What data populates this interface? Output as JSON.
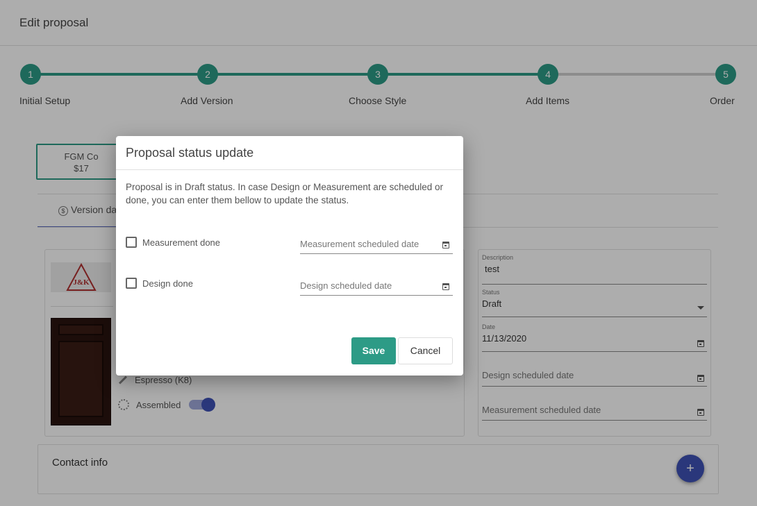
{
  "page": {
    "title": "Edit proposal"
  },
  "stepper": {
    "steps": [
      {
        "number": "1",
        "label": "Initial Setup"
      },
      {
        "number": "2",
        "label": "Add Version"
      },
      {
        "number": "3",
        "label": "Choose Style"
      },
      {
        "number": "4",
        "label": "Add Items"
      },
      {
        "number": "5",
        "label": "Order"
      }
    ],
    "completed_through": 4,
    "accent_color": "#2d9b86"
  },
  "version_card": {
    "name": "FGM Co",
    "price": "$17"
  },
  "tabs": {
    "active_label": "Version da"
  },
  "style": {
    "finish": "Espresso (K8)",
    "assembled_label": "Assembled",
    "assembled": true
  },
  "details": {
    "description_label": "Description",
    "description_value": "test",
    "status_label": "Status",
    "status_value": "Draft",
    "date_label": "Date",
    "date_value": "11/13/2020",
    "design_placeholder": "Design scheduled date",
    "measurement_placeholder": "Measurement scheduled date"
  },
  "contact": {
    "title": "Contact info"
  },
  "fab": {
    "icon": "plus-icon",
    "symbol": "+",
    "color": "#3f51b5"
  },
  "dialog": {
    "title": "Proposal status update",
    "message": "Proposal is in Draft status. In case Design or Measurement are scheduled or done, you can enter them bellow to update the status.",
    "measurement_done_label": "Measurement done",
    "measurement_date_placeholder": "Measurement scheduled date",
    "design_done_label": "Design done",
    "design_date_placeholder": "Design scheduled date",
    "save_label": "Save",
    "cancel_label": "Cancel"
  }
}
